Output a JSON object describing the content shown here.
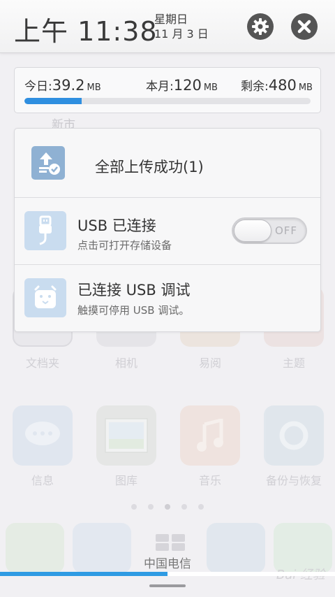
{
  "status_header": {
    "time": "上午 11:38",
    "weekday": "星期日",
    "date": "11 月 3 日",
    "settings_icon": "gear-icon",
    "close_icon": "close-icon"
  },
  "data_usage": {
    "today_label": "今日:",
    "today_value": "39.2",
    "today_unit": "MB",
    "month_label": "本月:",
    "month_value": "120",
    "month_unit": "MB",
    "remaining_label": "剩余:",
    "remaining_value": "480",
    "remaining_unit": "MB",
    "usage_fraction": 0.2,
    "bar_color": "#2f8fe0"
  },
  "notifications": [
    {
      "icon": "upload-success-icon",
      "title": "全部上传成功(1)"
    },
    {
      "icon": "usb-icon",
      "title": "USB 已连接",
      "subtitle": "点击可打开存储设备",
      "toggle_label": "OFF",
      "toggle_on": false
    },
    {
      "icon": "android-debug-icon",
      "title": "已连接 USB 调试",
      "subtitle": "触摸可停用 USB 调试。"
    }
  ],
  "background": {
    "behind_card_text": "新市",
    "app_labels_row1": [
      "文档夹",
      "相机",
      "易阅",
      "主题"
    ],
    "app_labels_row2": [
      "信息",
      "图库",
      "音乐",
      "备份与恢复"
    ],
    "carrier": "中国电信",
    "watermark": "Bai 经验"
  },
  "bottom_progress": {
    "fraction": 0.5,
    "color": "#2f9be3"
  }
}
